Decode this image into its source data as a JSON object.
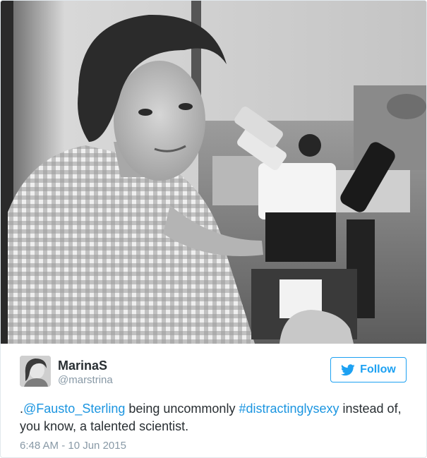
{
  "tweet": {
    "author": {
      "display_name": "MarinaS",
      "handle": "@marstrina"
    },
    "follow_button": {
      "label": "Follow",
      "icon": "twitter-bird-icon"
    },
    "text": {
      "prefix": ".",
      "mention": "@Fausto_Sterling",
      "middle": " being uncommonly ",
      "hashtag": "#distractinglysexy",
      "suffix": " instead of, you know, a talented scientist."
    },
    "timestamp": "6:48 AM - 10 Jun 2015"
  },
  "colors": {
    "accent": "#1da1f2",
    "link": "#1b95e0",
    "text": "#292f33",
    "muted": "#8899a6"
  }
}
